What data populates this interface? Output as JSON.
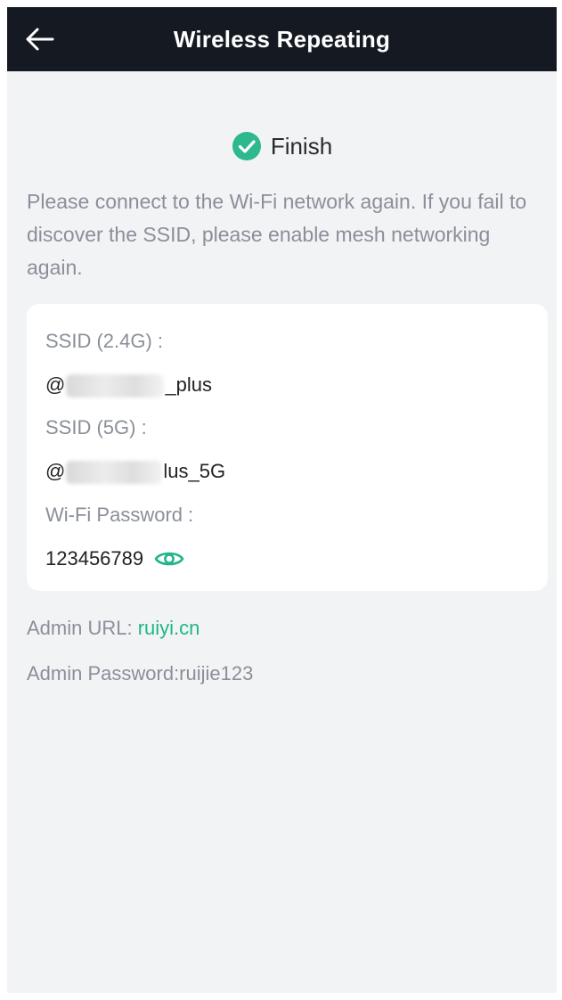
{
  "header": {
    "title": "Wireless Repeating",
    "back_icon": "arrow-left-icon"
  },
  "status": {
    "label": "Finish",
    "icon": "check-circle-icon",
    "color": "#2db88f"
  },
  "message": "Please connect to the Wi-Fi network again. If you fail to discover the SSID, please enable mesh networking again.",
  "card": {
    "ssid_24_label": "SSID (2.4G) :",
    "ssid_24_prefix": "@",
    "ssid_24_suffix": "_plus",
    "ssid_5_label": "SSID (5G) :",
    "ssid_5_prefix": "@",
    "ssid_5_suffix": "lus_5G",
    "password_label": "Wi-Fi Password :",
    "password_value": "123456789",
    "eye_icon": "eye-icon"
  },
  "admin": {
    "url_label": "Admin URL: ",
    "url_value": "ruiyi.cn",
    "password_line": "Admin Password:ruijie123"
  },
  "colors": {
    "header_bg": "#151a22",
    "page_bg": "#f2f3f5",
    "accent": "#22b58a",
    "muted_text": "#8a8f99"
  }
}
